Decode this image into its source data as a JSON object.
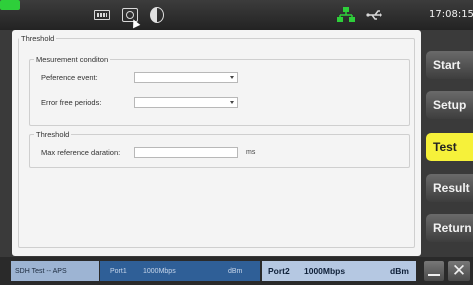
{
  "status_bar": {
    "time": "17:08:15",
    "icons": [
      "keyboard-icon",
      "screenshot-icon",
      "contrast-icon",
      "network-icon",
      "usb-icon",
      "battery-icon"
    ],
    "colors": {
      "network": "#2ecf3a",
      "battery": "#2ecf3a"
    }
  },
  "panel": {
    "group_title": "Threshold",
    "measurement": {
      "title": "Mesurement conditon",
      "reference_event_label": "Peference event:",
      "reference_event_value": "",
      "error_free_label": "Error free periods:",
      "error_free_value": ""
    },
    "threshold": {
      "title": "Threshold",
      "max_ref_label": "Max reference daration:",
      "max_ref_value": "",
      "unit": "ms"
    }
  },
  "side_buttons": {
    "start": "Start",
    "setup": "Setup",
    "test": "Test",
    "result": "Result",
    "return": "Return",
    "active": "test",
    "active_color": "#f6f13a"
  },
  "bottom_bar": {
    "test_label": "SDH Test -- APS",
    "port1_name": "Port1",
    "port1_rate": "1000Mbps",
    "port1_unit": "dBm",
    "port2_name": "Port2",
    "port2_rate": "1000Mbps",
    "port2_unit": "dBm"
  }
}
